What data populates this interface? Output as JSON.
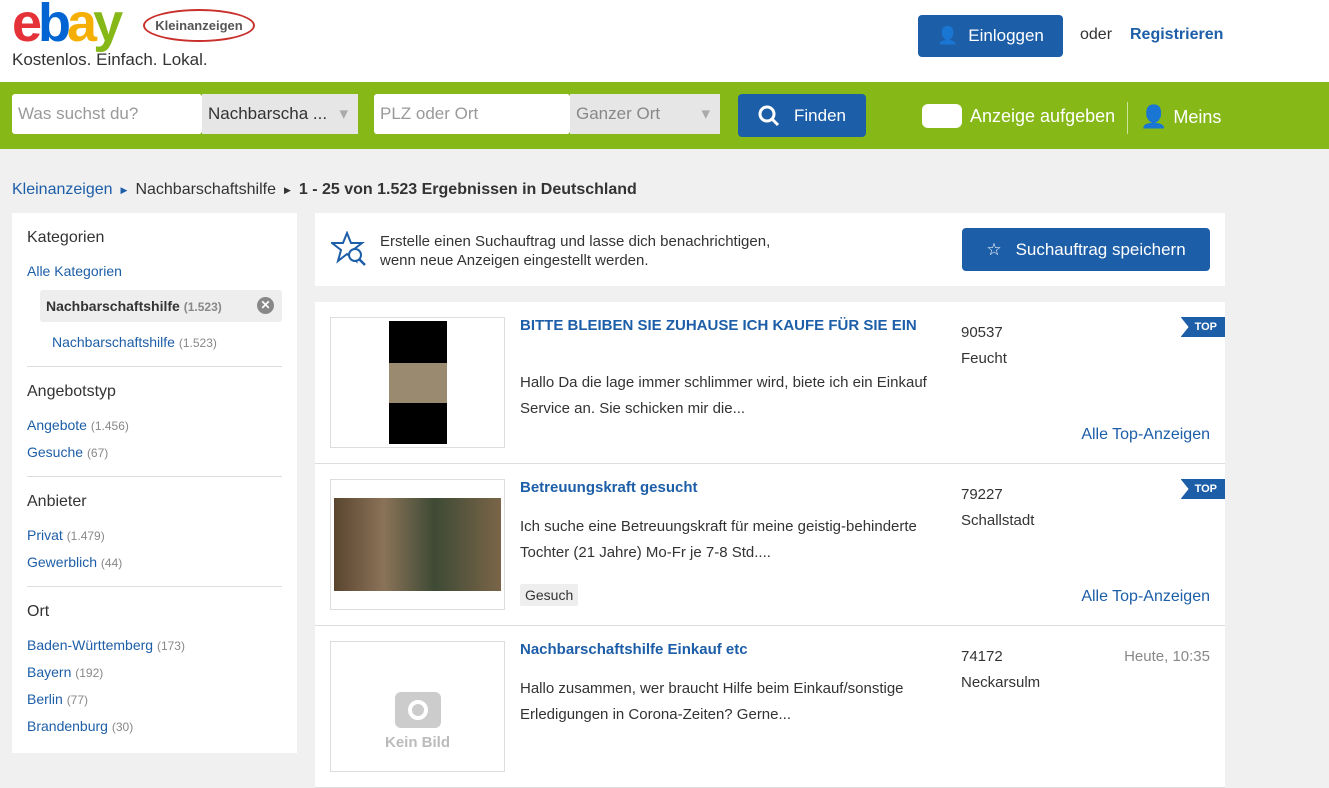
{
  "header": {
    "logo": "ebay",
    "logo_sub": "Kleinanzeigen",
    "tagline": "Kostenlos. Einfach. Lokal.",
    "login": "Einloggen",
    "oder": "oder",
    "register": "Registrieren"
  },
  "search": {
    "query_placeholder": "Was suchst du?",
    "category": "Nachbarscha ...",
    "location_placeholder": "PLZ oder Ort",
    "radius": "Ganzer Ort",
    "find": "Finden",
    "post_ad": "Anzeige aufgeben",
    "meins": "Meins"
  },
  "breadcrumb": {
    "root": "Kleinanzeigen",
    "category": "Nachbarschaftshilfe",
    "results": "1 - 25 von 1.523 Ergebnissen in Deutschland"
  },
  "sidebar": {
    "kategorien_title": "Kategorien",
    "all_categories": "Alle Kategorien",
    "selected": {
      "label": "Nachbarschaftshilfe",
      "count": "(1.523)"
    },
    "sub": {
      "label": "Nachbarschaftshilfe",
      "count": "(1.523)"
    },
    "angebotstyp_title": "Angebotstyp",
    "angebotstyp": [
      {
        "label": "Angebote",
        "count": "(1.456)"
      },
      {
        "label": "Gesuche",
        "count": "(67)"
      }
    ],
    "anbieter_title": "Anbieter",
    "anbieter": [
      {
        "label": "Privat",
        "count": "(1.479)"
      },
      {
        "label": "Gewerblich",
        "count": "(44)"
      }
    ],
    "ort_title": "Ort",
    "ort": [
      {
        "label": "Baden-Württemberg",
        "count": "(173)"
      },
      {
        "label": "Bayern",
        "count": "(192)"
      },
      {
        "label": "Berlin",
        "count": "(77)"
      },
      {
        "label": "Brandenburg",
        "count": "(30)"
      }
    ]
  },
  "search_alert": {
    "text1": "Erstelle einen Suchauftrag und lasse dich benachrichtigen,",
    "text2": "wenn neue Anzeigen eingestellt werden.",
    "button": "Suchauftrag speichern"
  },
  "listings": [
    {
      "title": "BITTE BLEIBEN SIE ZUHAUSE ICH KAUFE FÜR SIE EIN",
      "desc": "Hallo Da die lage immer schlimmer wird, biete ich ein Einkauf Service an. Sie schicken mir die...",
      "plz": "90537",
      "city": "Feucht",
      "badge": "TOP",
      "link": "Alle Top-Anzeigen"
    },
    {
      "title": "Betreuungskraft gesucht",
      "desc": "Ich suche eine Betreuungskraft für meine geistig-behinderte Tochter (21 Jahre) Mo-Fr je 7-8 Std....",
      "plz": "79227",
      "city": "Schallstadt",
      "badge": "TOP",
      "link": "Alle Top-Anzeigen",
      "tag": "Gesuch"
    },
    {
      "title": "Nachbarschaftshilfe Einkauf etc",
      "desc": "Hallo zusammen, wer braucht Hilfe beim Einkauf/sonstige Erledigungen in Corona-Zeiten? Gerne...",
      "plz": "74172",
      "city": "Neckarsulm",
      "date": "Heute, 10:35",
      "no_image": "Kein Bild"
    }
  ]
}
